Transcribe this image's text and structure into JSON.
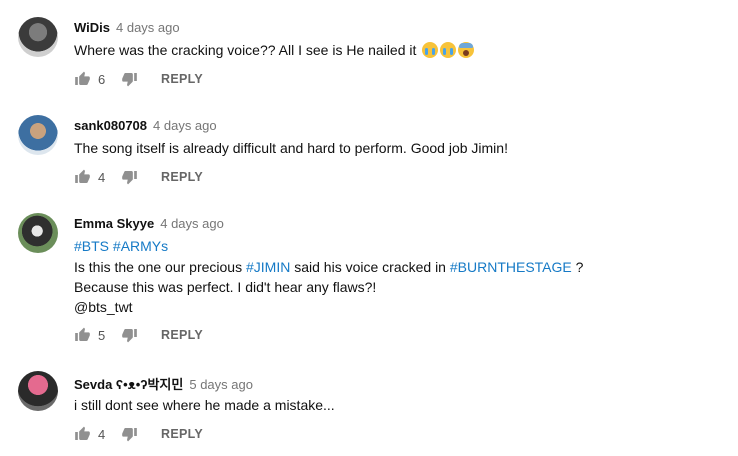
{
  "comments": [
    {
      "author": "WiDis",
      "time": "4 days ago",
      "text": "Where was the cracking voice?? All I see is He nailed it",
      "emojis": [
        "loudly-crying-face",
        "loudly-crying-face",
        "face-screaming-in-fear"
      ],
      "likes": "6",
      "reply": "REPLY"
    },
    {
      "author": "sank080708",
      "time": "4 days ago",
      "text": "The song itself is already difficult and hard to perform. Good job Jimin!",
      "likes": "4",
      "reply": "REPLY"
    },
    {
      "author": "Emma Skyye",
      "time": "4 days ago",
      "tags_line": "#BTS #ARMYs",
      "line2_pre": "Is this the one our precious ",
      "line2_tag1": "#JIMIN",
      "line2_mid": " said his voice cracked in ",
      "line2_tag2": "#BURNTHESTAGE",
      "line2_post": " ?",
      "line3": "Because this was perfect. I did't hear any flaws?!",
      "line4": "@bts_twt",
      "likes": "5",
      "reply": "REPLY"
    },
    {
      "author": "Sevda ʕ•ᴥ•ʔ박지민",
      "time": "5 days ago",
      "text": "i still dont see where he made a mistake...",
      "likes": "4",
      "reply": "REPLY"
    }
  ],
  "icons": {
    "like": "thumbs-up-icon",
    "dislike": "thumbs-down-icon"
  },
  "colors": {
    "hashtag": "#167ac6",
    "meta": "#767676"
  }
}
